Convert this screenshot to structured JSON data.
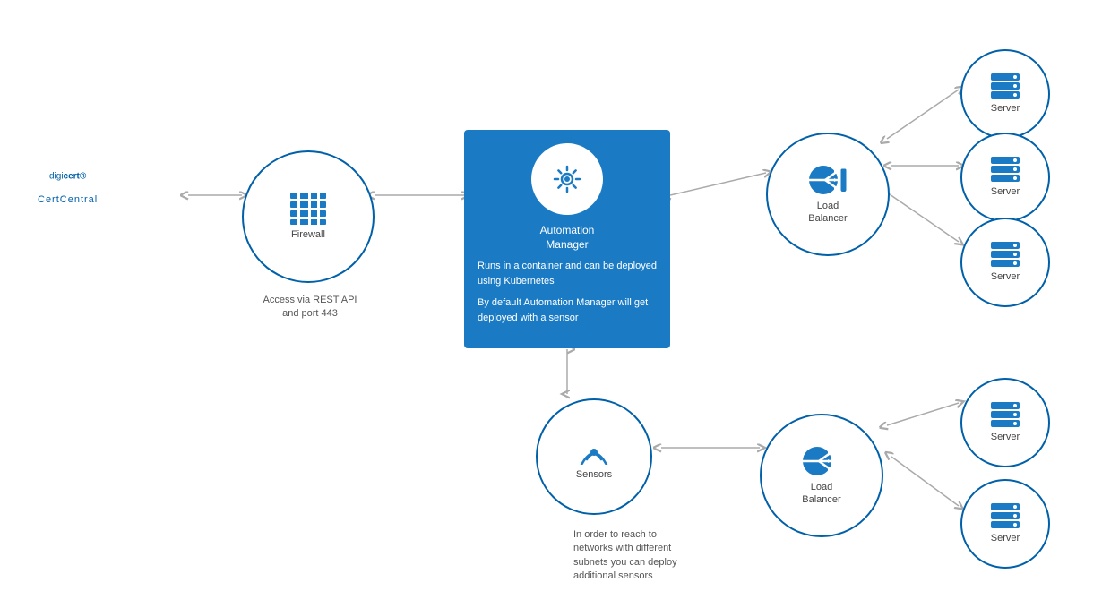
{
  "logo": {
    "brand": "digi",
    "brand_bold": "cert",
    "superscript": "®",
    "subtitle": "CertCentral"
  },
  "nodes": {
    "firewall": {
      "label": "Firewall",
      "sub_label": "Access via REST API\nand port 443"
    },
    "automation_manager": {
      "title": "Automation\nManager",
      "desc1": "Runs in a container and can be deployed using Kubernetes",
      "desc2": "By default Automation Manager will get deployed with a sensor"
    },
    "load_balancer_top": {
      "label": "Load\nBalancer"
    },
    "load_balancer_bottom": {
      "label": "Load\nBalancer"
    },
    "sensors": {
      "label": "Sensors"
    },
    "server_top1": {
      "label": "Server"
    },
    "server_top2": {
      "label": "Server"
    },
    "server_top3": {
      "label": "Server"
    },
    "server_bottom1": {
      "label": "Server"
    },
    "server_bottom2": {
      "label": "Server"
    }
  },
  "caption_sensors": "In order to reach to\nnetworks with different\nsubnets you can deploy\nadditional sensors",
  "colors": {
    "blue": "#1a7bc4",
    "light_blue": "#0060a9",
    "arrow": "#aaaaaa",
    "text": "#555555"
  }
}
